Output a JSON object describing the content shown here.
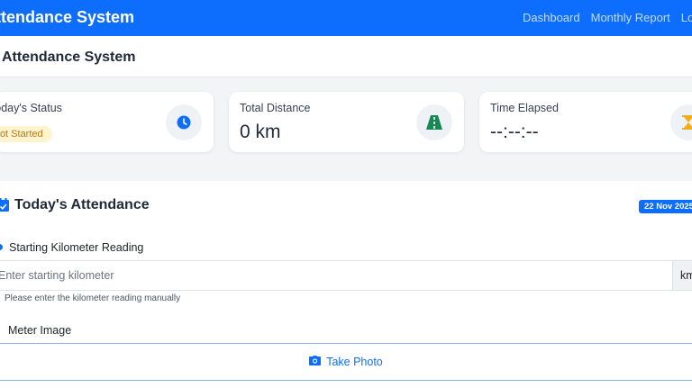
{
  "navbar": {
    "brand": "Attendance System",
    "links": [
      "Dashboard",
      "Monthly Report",
      "Logout"
    ]
  },
  "page_title": "Attendance System",
  "cards": {
    "status": {
      "label": "Today's Status",
      "badge": "Not Started",
      "icon": "clock-icon"
    },
    "distance": {
      "label": "Total Distance",
      "value": "0 km",
      "icon": "road-icon"
    },
    "elapsed": {
      "label": "Time Elapsed",
      "value": "--:--:--",
      "icon": "hourglass-icon"
    }
  },
  "attendance": {
    "title": "Today's Attendance",
    "date": "22 Nov 2025",
    "km_label": "Starting Kilometer Reading",
    "km_placeholder": "Enter starting kilometer",
    "km_unit": "km",
    "km_help": "Please enter the kilometer reading manually",
    "meter_label": "Meter Image",
    "photo_button": "Take Photo"
  },
  "colors": {
    "primary": "#0d6efd",
    "warning_bg": "#fdf3cd",
    "warning_text": "#b7791f",
    "success": "#198754",
    "hourglass": "#f0ad1e"
  }
}
